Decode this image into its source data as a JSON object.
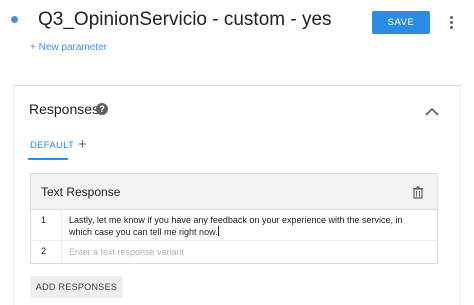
{
  "header": {
    "intent_name": "Q3_OpinionServicio - custom - yes",
    "save_label": "SAVE",
    "status_color": "#4a90e2",
    "accent_color": "#2b8be8"
  },
  "parameters": {
    "new_parameter_label": "+ New parameter"
  },
  "responses": {
    "title": "Responses",
    "help_icon": "help-circle-icon",
    "collapse_icon": "chevron-up-icon",
    "tabs": [
      {
        "label": "DEFAULT",
        "active": true
      }
    ],
    "add_tab_label": "+",
    "text_response": {
      "title": "Text Response",
      "delete_icon": "trash-icon",
      "rows": [
        {
          "number": "1",
          "text": "Lastly, let me know if you have any feedback on your experience with the service, in which case you can tell me right now."
        },
        {
          "number": "2",
          "value": "",
          "placeholder": "Enter a text response variant"
        }
      ]
    },
    "add_responses_label": "ADD RESPONSES"
  }
}
